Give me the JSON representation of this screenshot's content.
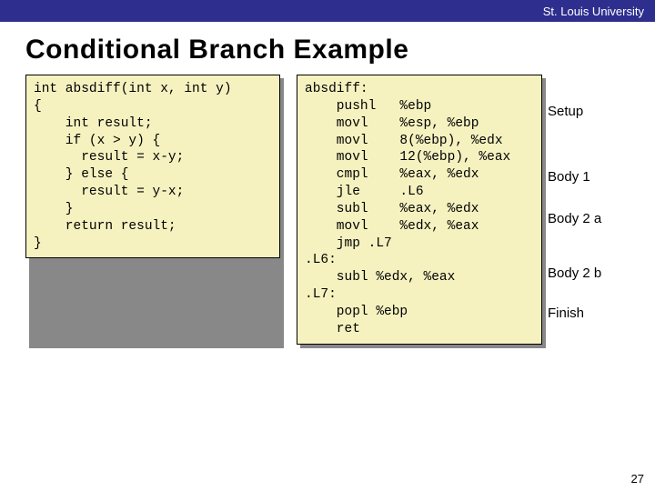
{
  "header": {
    "org": "St. Louis University"
  },
  "title": "Conditional Branch Example",
  "code_c": "int absdiff(int x, int y)\n{\n    int result;\n    if (x > y) {\n      result = x-y;\n    } else {\n      result = y-x;\n    }\n    return result;\n}",
  "code_asm": "absdiff:\n    pushl   %ebp\n    movl    %esp, %ebp\n    movl    8(%ebp), %edx\n    movl    12(%ebp), %eax\n    cmpl    %eax, %edx\n    jle     .L6\n    subl    %eax, %edx\n    movl    %edx, %eax\n    jmp .L7\n.L6:\n    subl %edx, %eax\n.L7:\n    popl %ebp\n    ret",
  "labels": {
    "setup": "Setup",
    "body1": "Body 1",
    "body2a": "Body 2 a",
    "body2b": "Body 2 b",
    "finish": "Finish"
  },
  "pagenum": "27"
}
